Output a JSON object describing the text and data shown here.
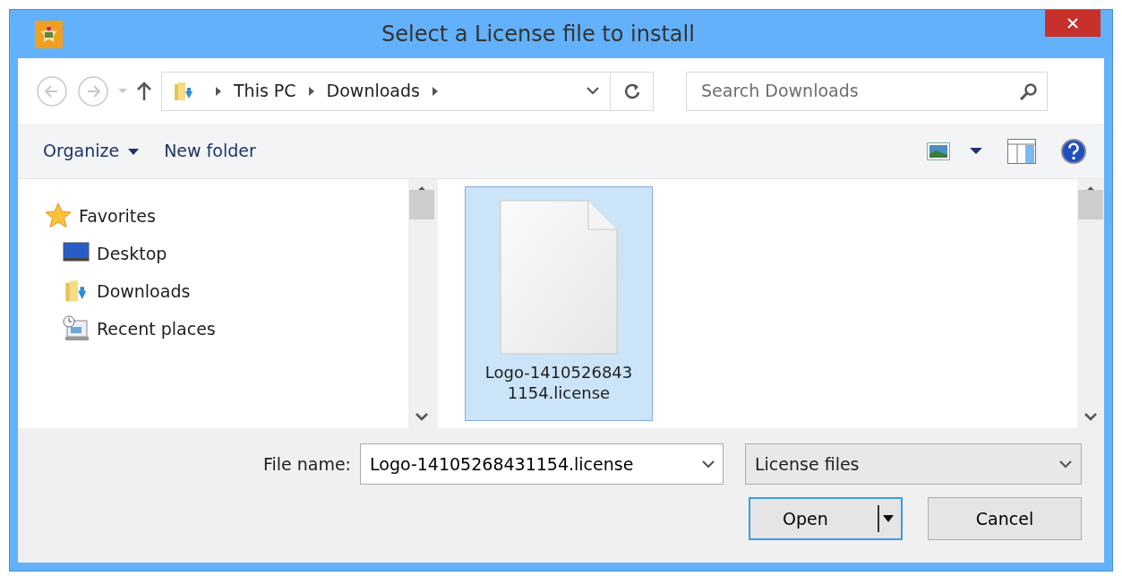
{
  "window": {
    "title": "Select a License file to install"
  },
  "history": [
    {
      "kind": "back",
      "disabled": true
    },
    {
      "kind": "forward",
      "disabled": true
    }
  ],
  "address": {
    "crumbs": [
      "This PC",
      "Downloads"
    ]
  },
  "search": {
    "placeholder": "Search Downloads"
  },
  "toolbar": [
    {
      "label": "Organize",
      "kind": "menu"
    },
    {
      "label": "New folder",
      "kind": "plain"
    }
  ],
  "navigation": [
    {
      "label": "Favorites",
      "kind": "star",
      "children": [
        {
          "label": "Desktop",
          "kind": "desktop"
        },
        {
          "label": "Downloads",
          "kind": "downloads"
        },
        {
          "label": "Recent places",
          "kind": "recent"
        }
      ]
    }
  ],
  "files": [
    {
      "name": "Logo-14105268431154.license",
      "selected": true
    }
  ],
  "file_name": {
    "label": "File name:",
    "value": "Logo-14105268431154.license"
  },
  "file_type": {
    "value": "License files"
  },
  "buttons": [
    {
      "label": "Open",
      "kind": "split",
      "default": true
    },
    {
      "label": "Cancel",
      "kind": "plain",
      "default": false
    }
  ]
}
